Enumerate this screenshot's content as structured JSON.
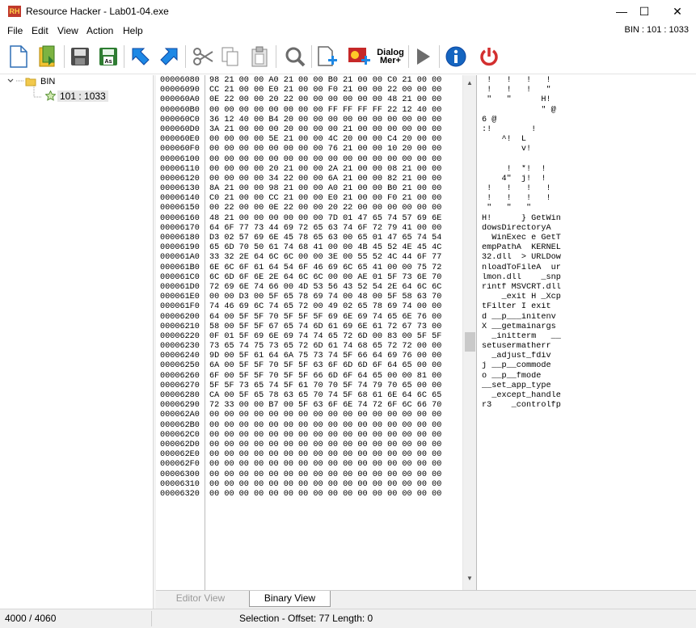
{
  "window": {
    "logo_text": "RH",
    "title": "Resource Hacker - Lab01-04.exe",
    "minimize_glyph": "—",
    "maximize_glyph": "☐",
    "close_glyph": "✕"
  },
  "menu": {
    "items": [
      "File",
      "Edit",
      "View",
      "Action",
      "Help"
    ],
    "bin_id": "BIN : 101 : 1033"
  },
  "toolbar": {
    "dialog_merge_label_1": "Dialog",
    "dialog_merge_label_2": "Mer+",
    "icons": [
      "new-file-icon",
      "open-file-icon",
      "save-icon",
      "save-as-icon",
      "back-arrow-icon",
      "forward-arrow-icon",
      "cut-icon",
      "copy-icon",
      "paste-icon",
      "find-icon",
      "add-resource-icon",
      "replace-resource-icon",
      "dialog-merger-icon",
      "run-script-icon",
      "info-icon",
      "power-icon"
    ]
  },
  "tree": {
    "root_label": "BIN",
    "child_label": "101 : 1033"
  },
  "hex": {
    "rows": [
      {
        "addr": "00006080",
        "hex": "98 21 00 00 A0 21 00 00 B0 21 00 00 C0 21 00 00",
        "ascii": " !   !   !   !"
      },
      {
        "addr": "00006090",
        "hex": "CC 21 00 00 E0 21 00 00 F0 21 00 00 22 00 00 00",
        "ascii": " !   !   !   \""
      },
      {
        "addr": "000060A0",
        "hex": "0E 22 00 00 20 22 00 00 00 00 00 00 48 21 00 00",
        "ascii": " \"   \"      H!"
      },
      {
        "addr": "000060B0",
        "hex": "00 00 00 00 00 00 00 00 FF FF FF FF 22 12 40 00",
        "ascii": "            \" @"
      },
      {
        "addr": "000060C0",
        "hex": "36 12 40 00 B4 20 00 00 00 00 00 00 00 00 00 00",
        "ascii": "6 @"
      },
      {
        "addr": "000060D0",
        "hex": "3A 21 00 00 00 20 00 00 00 21 00 00 00 00 00 00",
        "ascii": ":!        !"
      },
      {
        "addr": "000060E0",
        "hex": "00 00 00 00 5E 21 00 00 4C 20 00 00 C4 20 00 00",
        "ascii": "    ^!  L"
      },
      {
        "addr": "000060F0",
        "hex": "00 00 00 00 00 00 00 00 76 21 00 00 10 20 00 00",
        "ascii": "        v!"
      },
      {
        "addr": "00006100",
        "hex": "00 00 00 00 00 00 00 00 00 00 00 00 00 00 00 00",
        "ascii": ""
      },
      {
        "addr": "00006110",
        "hex": "00 00 00 00 20 21 00 00 2A 21 00 00 08 21 00 00",
        "ascii": "     !  *!  !"
      },
      {
        "addr": "00006120",
        "hex": "00 00 00 00 34 22 00 00 6A 21 00 00 82 21 00 00",
        "ascii": "    4\"  j!  !"
      },
      {
        "addr": "00006130",
        "hex": "8A 21 00 00 98 21 00 00 A0 21 00 00 B0 21 00 00",
        "ascii": " !   !   !   !"
      },
      {
        "addr": "00006140",
        "hex": "C0 21 00 00 CC 21 00 00 E0 21 00 00 F0 21 00 00",
        "ascii": " !   !   !   !"
      },
      {
        "addr": "00006150",
        "hex": "00 22 00 00 0E 22 00 00 20 22 00 00 00 00 00 00",
        "ascii": " \"   \"   \""
      },
      {
        "addr": "00006160",
        "hex": "48 21 00 00 00 00 00 00 7D 01 47 65 74 57 69 6E",
        "ascii": "H!      } GetWin"
      },
      {
        "addr": "00006170",
        "hex": "64 6F 77 73 44 69 72 65 63 74 6F 72 79 41 00 00",
        "ascii": "dowsDirectoryA"
      },
      {
        "addr": "00006180",
        "hex": "D3 02 57 69 6E 45 78 65 63 00 65 01 47 65 74 54",
        "ascii": "  WinExec e GetT"
      },
      {
        "addr": "00006190",
        "hex": "65 6D 70 50 61 74 68 41 00 00 4B 45 52 4E 45 4C",
        "ascii": "empPathA  KERNEL"
      },
      {
        "addr": "000061A0",
        "hex": "33 32 2E 64 6C 6C 00 00 3E 00 55 52 4C 44 6F 77",
        "ascii": "32.dll  > URLDow"
      },
      {
        "addr": "000061B0",
        "hex": "6E 6C 6F 61 64 54 6F 46 69 6C 65 41 00 00 75 72",
        "ascii": "nloadToFileA  ur"
      },
      {
        "addr": "000061C0",
        "hex": "6C 6D 6F 6E 2E 64 6C 6C 00 00 AE 01 5F 73 6E 70",
        "ascii": "lmon.dll    _snp"
      },
      {
        "addr": "000061D0",
        "hex": "72 69 6E 74 66 00 4D 53 56 43 52 54 2E 64 6C 6C",
        "ascii": "rintf MSVCRT.dll"
      },
      {
        "addr": "000061E0",
        "hex": "00 00 D3 00 5F 65 78 69 74 00 48 00 5F 58 63 70",
        "ascii": "    _exit H _Xcp"
      },
      {
        "addr": "000061F0",
        "hex": "74 46 69 6C 74 65 72 00 49 02 65 78 69 74 00 00",
        "ascii": "tFilter I exit"
      },
      {
        "addr": "00006200",
        "hex": "64 00 5F 5F 70 5F 5F 5F 69 6E 69 74 65 6E 76 00",
        "ascii": "d __p___initenv"
      },
      {
        "addr": "00006210",
        "hex": "58 00 5F 5F 67 65 74 6D 61 69 6E 61 72 67 73 00",
        "ascii": "X __getmainargs"
      },
      {
        "addr": "00006220",
        "hex": "0F 01 5F 69 6E 69 74 74 65 72 6D 00 83 00 5F 5F",
        "ascii": "  _initterm   __"
      },
      {
        "addr": "00006230",
        "hex": "73 65 74 75 73 65 72 6D 61 74 68 65 72 72 00 00",
        "ascii": "setusermatherr"
      },
      {
        "addr": "00006240",
        "hex": "9D 00 5F 61 64 6A 75 73 74 5F 66 64 69 76 00 00",
        "ascii": "  _adjust_fdiv"
      },
      {
        "addr": "00006250",
        "hex": "6A 00 5F 5F 70 5F 5F 63 6F 6D 6D 6F 64 65 00 00",
        "ascii": "j __p__commode"
      },
      {
        "addr": "00006260",
        "hex": "6F 00 5F 5F 70 5F 5F 66 6D 6F 64 65 00 00 81 00",
        "ascii": "o __p__fmode"
      },
      {
        "addr": "00006270",
        "hex": "5F 5F 73 65 74 5F 61 70 70 5F 74 79 70 65 00 00",
        "ascii": "__set_app_type"
      },
      {
        "addr": "00006280",
        "hex": "CA 00 5F 65 78 63 65 70 74 5F 68 61 6E 64 6C 65",
        "ascii": "  _except_handle"
      },
      {
        "addr": "00006290",
        "hex": "72 33 00 00 B7 00 5F 63 6F 6E 74 72 6F 6C 66 70",
        "ascii": "r3    _controlfp"
      },
      {
        "addr": "000062A0",
        "hex": "00 00 00 00 00 00 00 00 00 00 00 00 00 00 00 00",
        "ascii": ""
      },
      {
        "addr": "000062B0",
        "hex": "00 00 00 00 00 00 00 00 00 00 00 00 00 00 00 00",
        "ascii": ""
      },
      {
        "addr": "000062C0",
        "hex": "00 00 00 00 00 00 00 00 00 00 00 00 00 00 00 00",
        "ascii": ""
      },
      {
        "addr": "000062D0",
        "hex": "00 00 00 00 00 00 00 00 00 00 00 00 00 00 00 00",
        "ascii": ""
      },
      {
        "addr": "000062E0",
        "hex": "00 00 00 00 00 00 00 00 00 00 00 00 00 00 00 00",
        "ascii": ""
      },
      {
        "addr": "000062F0",
        "hex": "00 00 00 00 00 00 00 00 00 00 00 00 00 00 00 00",
        "ascii": ""
      },
      {
        "addr": "00006300",
        "hex": "00 00 00 00 00 00 00 00 00 00 00 00 00 00 00 00",
        "ascii": ""
      },
      {
        "addr": "00006310",
        "hex": "00 00 00 00 00 00 00 00 00 00 00 00 00 00 00 00",
        "ascii": ""
      },
      {
        "addr": "00006320",
        "hex": "00 00 00 00 00 00 00 00 00 00 00 00 00 00 00 00",
        "ascii": ""
      }
    ]
  },
  "tabs": {
    "editor": "Editor View",
    "binary": "Binary View"
  },
  "status": {
    "count": "4000 / 4060",
    "selection": "Selection - Offset: 77 Length: 0"
  }
}
